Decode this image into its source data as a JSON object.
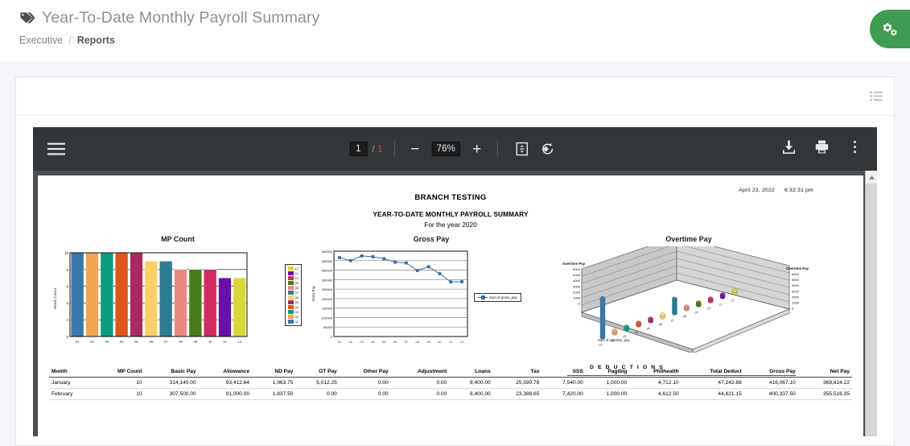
{
  "header": {
    "title": "Year-To-Date Monthly Payroll Summary",
    "tag_icon": "tag-icon",
    "breadcrumb": {
      "parent": "Executive",
      "separator": "/",
      "current": "Reports"
    },
    "fab": {
      "icon": "gears-icon",
      "color": "#3f9c50"
    }
  },
  "card": {
    "list_icon": "list-icon"
  },
  "pdf_toolbar": {
    "menu_icon": "hamburger-icon",
    "page_current": "1",
    "page_separator": "/",
    "page_total": "1",
    "zoom_out": "−",
    "zoom_value": "76%",
    "zoom_in": "+",
    "fit_icon": "fit-page-icon",
    "rotate_icon": "rotate-icon",
    "download_icon": "download-icon",
    "print_icon": "print-icon",
    "more_icon": "more-vertical-icon"
  },
  "report": {
    "datetime_date": "April 23, 2022",
    "datetime_time": "6:32:31 pm",
    "branch": "BRANCH TESTING",
    "subtitle": "YEAR-TO-DATE MONTHLY PAYROLL SUMMARY",
    "year_line": "For the year 2020",
    "deductions_group": "D E D U C T I O N S"
  },
  "chart_data": [
    {
      "type": "bar",
      "title": "MP Count",
      "xlabel": "",
      "ylabel": "Head Count",
      "categories": [
        "01",
        "02",
        "03",
        "04",
        "05",
        "06",
        "07",
        "08",
        "09",
        "10",
        "11",
        "12"
      ],
      "values": [
        10,
        10,
        10,
        10,
        10,
        9,
        9,
        8,
        8,
        8,
        7,
        7
      ],
      "ylim": [
        0,
        10
      ],
      "yticks": [
        0,
        2,
        4,
        6,
        8,
        10
      ],
      "grid": true,
      "legend_position": "right",
      "legend": [
        "12",
        "11",
        "10",
        "09",
        "08",
        "07",
        "06",
        "05",
        "04",
        "03",
        "02",
        "01"
      ],
      "colors": [
        "#3b77a8",
        "#f2a34e",
        "#0f9b7e",
        "#e0541f",
        "#a62b62",
        "#fbd06a",
        "#2e7b92",
        "#e88a7d",
        "#4b7a18",
        "#cf2a62",
        "#6a0fa8",
        "#d9d83a"
      ]
    },
    {
      "type": "line",
      "title": "Gross Pay",
      "xlabel": "",
      "ylabel": "Gross Pay",
      "categories": [
        "01",
        "02",
        "03",
        "04",
        "05",
        "06",
        "07",
        "08",
        "09",
        "10",
        "11",
        "12"
      ],
      "series": [
        {
          "name": "Sum of gross_pay",
          "values": [
            416067,
            400338,
            425000,
            421000,
            410000,
            392000,
            388000,
            348000,
            368000,
            331000,
            288000,
            289000
          ]
        }
      ],
      "ylim": [
        0,
        450000
      ],
      "yticks": [
        0,
        50000,
        100000,
        150000,
        200000,
        250000,
        300000,
        350000,
        400000,
        450000
      ],
      "grid": true,
      "legend_position": "right",
      "color": "#3b6ea5"
    },
    {
      "type": "bar",
      "title": "Overtime Pay",
      "subtype": "3d-cylinder",
      "xlabel": "Sum of overtime_pay",
      "ylabel": "Overtime Pay",
      "ylabel_right": "Overtime Pay",
      "categories": [
        "01",
        "02",
        "03",
        "04",
        "05",
        "06",
        "07",
        "08",
        "09",
        "10",
        "11",
        "12"
      ],
      "values": [
        5012.25,
        0,
        0,
        0,
        0,
        0,
        1837,
        0,
        0,
        0,
        0,
        0
      ],
      "ylim": [
        0,
        6000
      ],
      "yticks": [
        0,
        1000,
        2000,
        3000,
        4000,
        5000,
        6000
      ],
      "grid": true,
      "legend_position": "none"
    }
  ],
  "table": {
    "columns": [
      "Month",
      "MP Count",
      "Basic Pay",
      "Allowance",
      "ND Pay",
      "OT Pay",
      "Other Pay",
      "Adjustment",
      "Loans",
      "Tax",
      "SSS",
      "Pagibig",
      "Philhealth",
      "Total Deduct",
      "Gross Pay",
      "Net Pay"
    ],
    "rows": [
      [
        "January",
        "10",
        "314,140.00",
        "93,412.64",
        "1,963.75",
        "5,012.25",
        "0.00",
        "0.00",
        "8,400.00",
        "25,590.78",
        "7,540.00",
        "1,000.00",
        "4,712.10",
        "47,242.88",
        "416,067.10",
        "368,824.22"
      ],
      [
        "February",
        "10",
        "307,500.00",
        "91,000.00",
        "1,837.50",
        "0.00",
        "0.00",
        "0.00",
        "8,400.00",
        "23,388.65",
        "7,420.00",
        "1,000.00",
        "4,612.50",
        "44,821.15",
        "400,337.50",
        "355,516.35"
      ]
    ]
  }
}
